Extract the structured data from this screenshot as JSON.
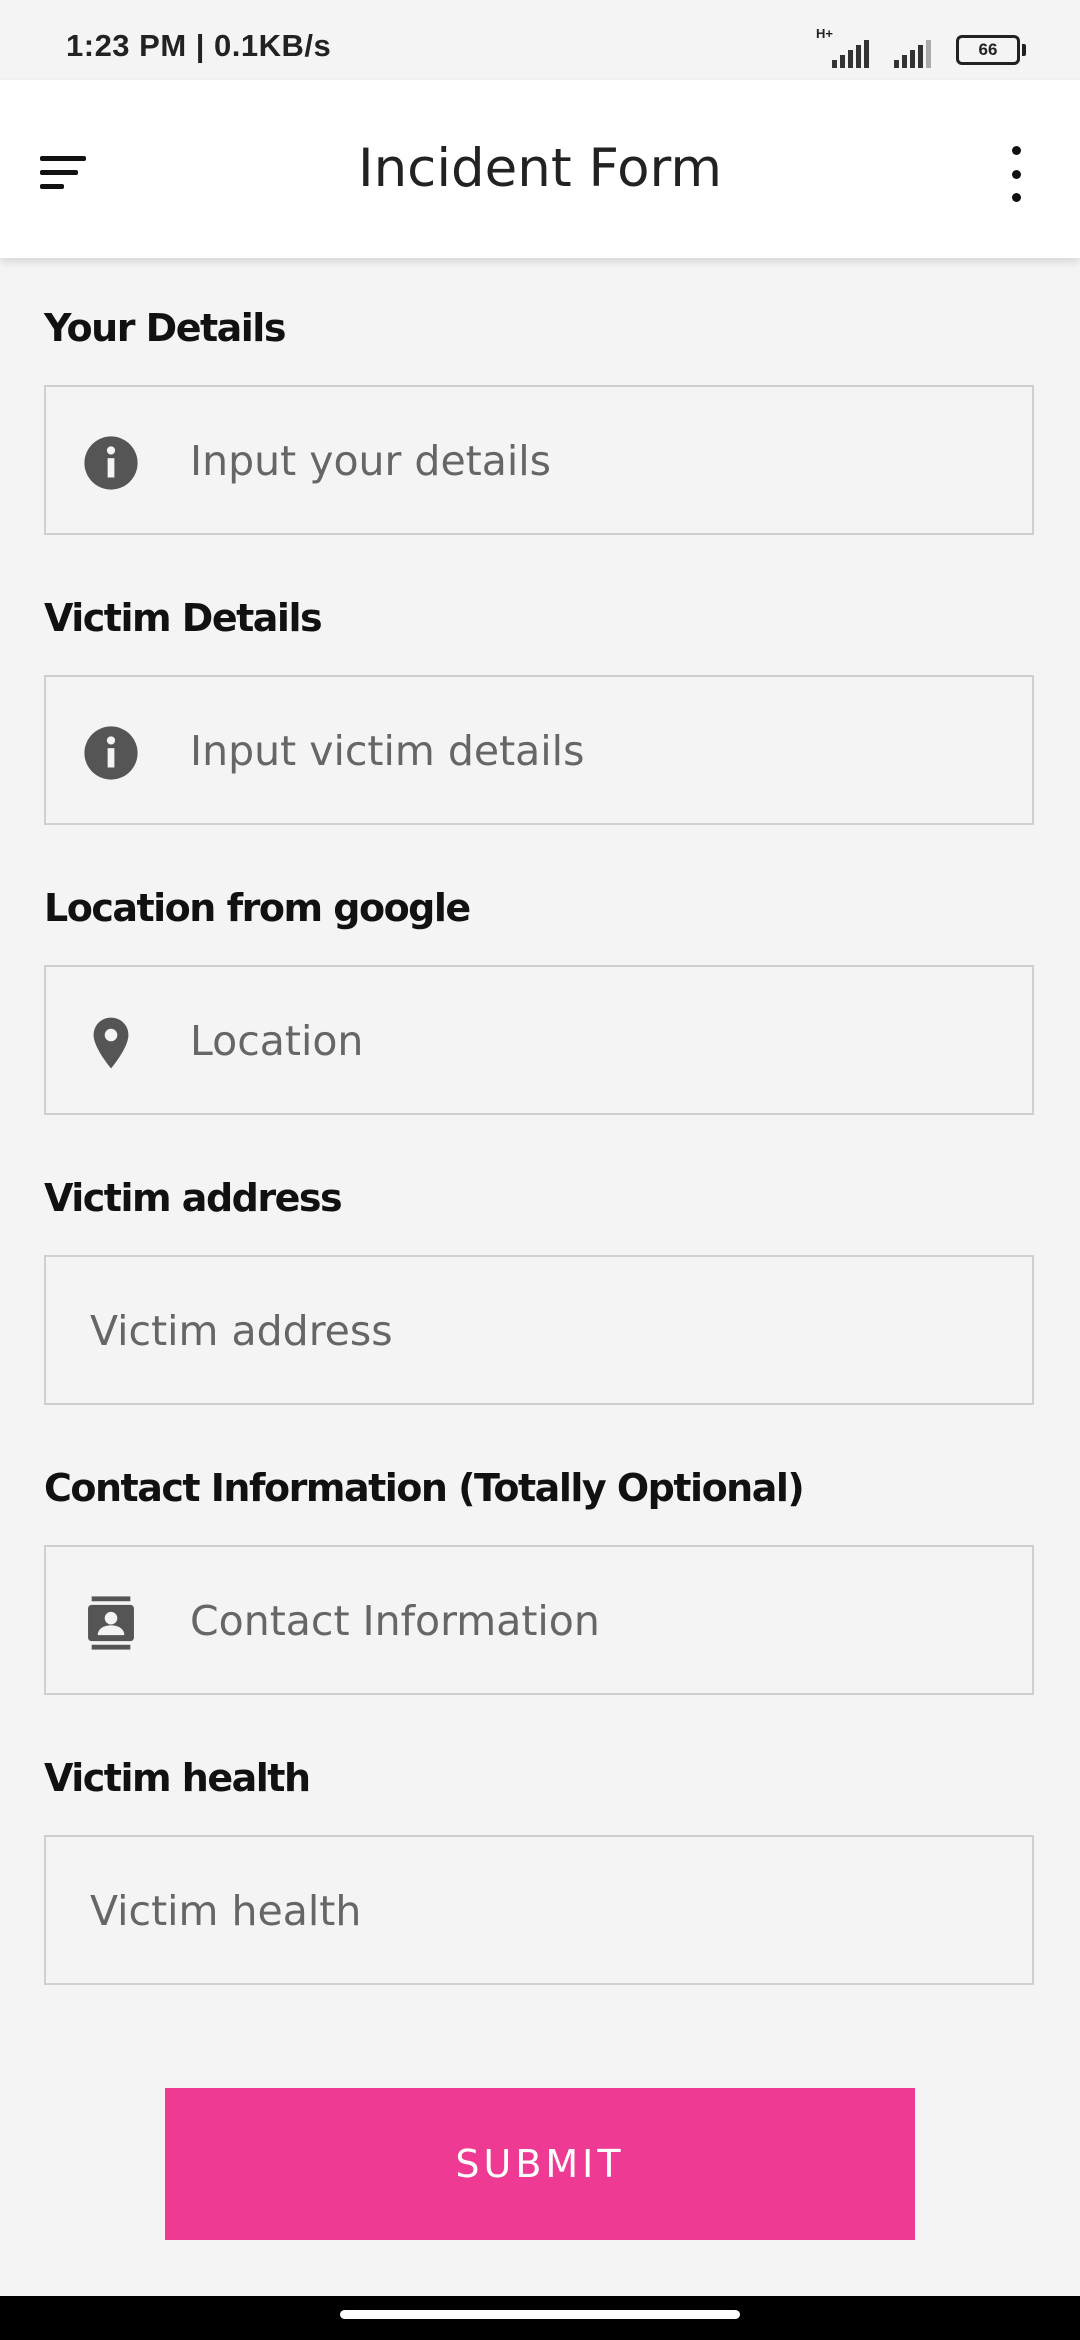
{
  "status_bar": {
    "time": "1:23 PM | 0.1KB/s",
    "network_type": "H+",
    "battery": "66"
  },
  "app_bar": {
    "title": "Incident Form",
    "menu_icon": "menu-icon",
    "more_icon": "more-vert-icon"
  },
  "form": {
    "fields": [
      {
        "label": "Your Details",
        "placeholder": "Input your details",
        "icon": "info-icon"
      },
      {
        "label": "Victim Details",
        "placeholder": "Input victim details",
        "icon": "info-icon"
      },
      {
        "label": "Location from google",
        "placeholder": "Location",
        "icon": "location-pin-icon"
      },
      {
        "label": "Victim address",
        "placeholder": "Victim address",
        "icon": ""
      },
      {
        "label": "Contact Information (Totally Optional)",
        "placeholder": "Contact Information",
        "icon": "contact-card-icon"
      },
      {
        "label": "Victim health",
        "placeholder": "Victim health",
        "icon": ""
      }
    ],
    "submit_label": "SUBMIT"
  },
  "colors": {
    "accent": "#ee3a92",
    "background": "#f4f4f4",
    "app_bar": "#ffffff"
  }
}
